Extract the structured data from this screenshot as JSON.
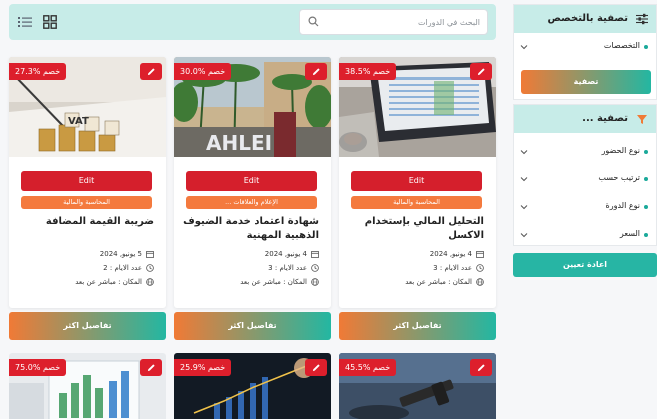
{
  "toolbar": {
    "search_placeholder": "البحث في الدورات",
    "icons": [
      "search-icon",
      "grid-view-icon",
      "list-view-icon"
    ]
  },
  "courses": [
    {
      "discount": "38.5% خصم",
      "edit_label": "Edit",
      "category": "المحاسبة والمالية",
      "title": "التحليل المالي بإستخدام الاكسل",
      "date": "4 يونيو, 2024",
      "days": "عدد الايام : 3",
      "location": "المكان : مباشر عن بعد",
      "details_label": "تفاصيل اكثر",
      "image": "laptop-spreadsheet-photo"
    },
    {
      "discount": "30.0% خصم",
      "edit_label": "Edit",
      "category": "الإعلام والعلاقات ...",
      "title": "شهادة اعتماد خدمة الضيوف الذهبية المهنية",
      "date": "4 يونيو, 2024",
      "days": "عدد الايام : 3",
      "location": "المكان : مباشر عن بعد",
      "details_label": "تفاصيل اكثر",
      "image": "hotel-ahlei-photo",
      "image_text": "AHLEI"
    },
    {
      "discount": "27.3% خصم",
      "edit_label": "Edit",
      "category": "المحاسبة والمالية",
      "title": "ضريبة القيمة المضافة",
      "date": "5 يونيو, 2024",
      "days": "عدد الايام : 2",
      "location": "المكان : مباشر عن بعد",
      "details_label": "تفاصيل اكثر",
      "image": "vat-coins-photo",
      "image_text": "VAT"
    }
  ],
  "courses_row2": [
    {
      "discount": "45.5% خصم",
      "image": "gavel-photo"
    },
    {
      "discount": "25.9% خصم",
      "image": "growth-chart-photo"
    },
    {
      "discount": "75.0% خصم",
      "image": "charts-photo"
    }
  ],
  "sidebar": {
    "specialty_title": "تصفية بالتخصص",
    "specialty_filter": "التخصصات",
    "filter_button": "تصفية",
    "filter_title": "تصفية ...",
    "filters": [
      "نوع الحضور",
      "ترتيب حسب",
      "نوع الدورة",
      "السعر"
    ],
    "reset_button": "اعادة تعيين"
  },
  "colors": {
    "accent_teal": "#c7ece8",
    "badge_red": "#dd1f2c",
    "category_orange": "#f47a3e",
    "gradient_start": "#f07a36",
    "gradient_end": "#23b7a2",
    "reset_teal": "#27b5a4"
  }
}
